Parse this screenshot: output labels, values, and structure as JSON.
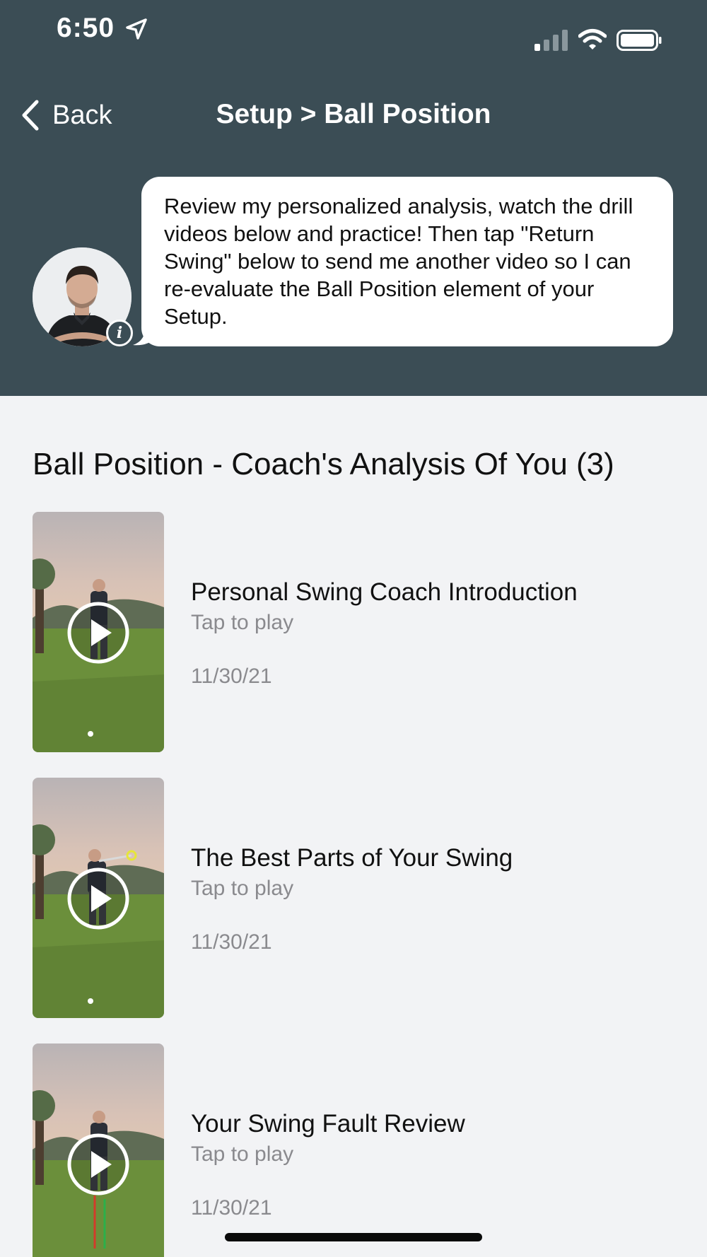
{
  "status_bar": {
    "time": "6:50",
    "icons": [
      "location-arrow-icon",
      "cellular-signal-icon",
      "wifi-icon",
      "battery-icon"
    ]
  },
  "nav": {
    "back_label": "Back",
    "title": "Setup > Ball Position"
  },
  "coach": {
    "avatar": "coach-avatar",
    "message": "Review my personalized analysis, watch the drill videos below and practice! Then tap \"Return Swing\" below to send me another video so I can re-evaluate the Ball Position element of your Setup."
  },
  "section": {
    "title": "Ball Position - Coach's Analysis Of You (3)"
  },
  "videos": [
    {
      "title": "Personal Swing Coach Introduction",
      "subtitle": "Tap to play",
      "date": "11/30/21"
    },
    {
      "title": "The Best Parts of Your Swing",
      "subtitle": "Tap to play",
      "date": "11/30/21"
    },
    {
      "title": "Your Swing Fault Review",
      "subtitle": "Tap to play",
      "date": "11/30/21"
    }
  ],
  "colors": {
    "header_bg": "#3b4d55",
    "page_bg": "#f2f3f5",
    "secondary_text": "#8a8a8e"
  }
}
